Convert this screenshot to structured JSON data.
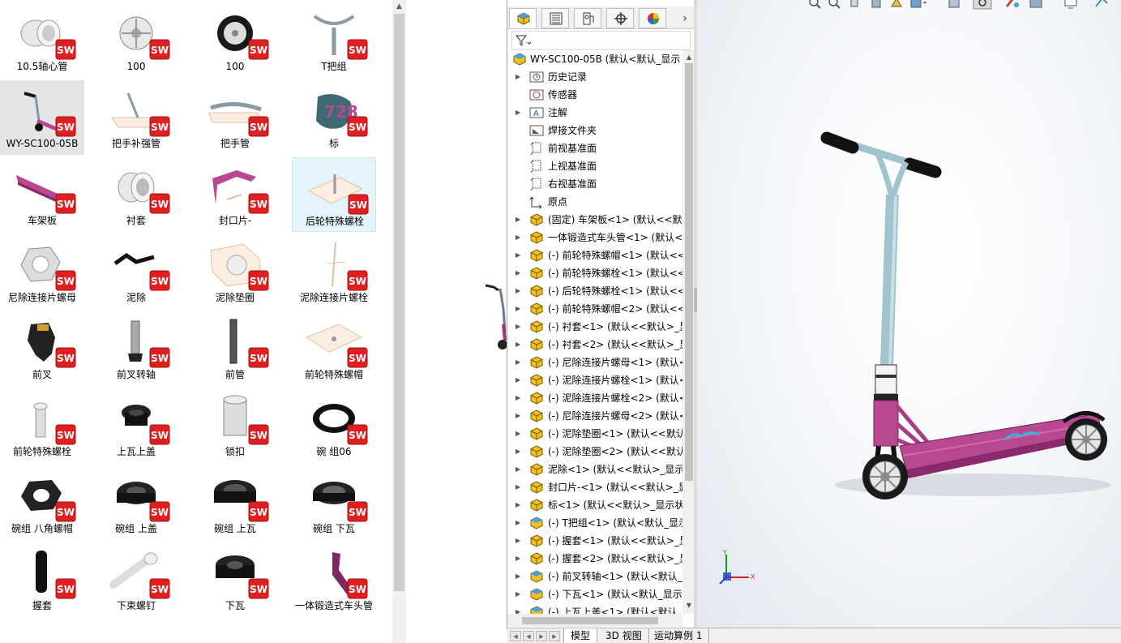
{
  "explorer": {
    "tiles": [
      {
        "label": "10.5轴心管",
        "icon": "tube-part-icon"
      },
      {
        "label": "100",
        "icon": "wheel-rim-icon"
      },
      {
        "label": "100",
        "icon": "wheel-icon"
      },
      {
        "label": "T把组",
        "icon": "t-bar-icon"
      },
      {
        "label": "WY-SC100-05B",
        "icon": "scooter-assembly-icon",
        "selected": true
      },
      {
        "label": "把手补强管",
        "icon": "handlebar-brace-icon"
      },
      {
        "label": "把手管",
        "icon": "handlebar-tube-icon"
      },
      {
        "label": "标",
        "icon": "logo-decal-icon"
      },
      {
        "label": "车架板",
        "icon": "deck-plate-icon"
      },
      {
        "label": "衬套",
        "icon": "bushing-icon"
      },
      {
        "label": "封口片-",
        "icon": "end-cap-icon"
      },
      {
        "label": "后轮特殊螺栓",
        "icon": "rear-axle-bolt-icon",
        "hover": true
      },
      {
        "label": "尼除连接片螺母",
        "icon": "lock-nut-icon"
      },
      {
        "label": "泥除",
        "icon": "fender-icon"
      },
      {
        "label": "泥除垫圈",
        "icon": "fender-washer-icon"
      },
      {
        "label": "泥除连接片螺栓",
        "icon": "fender-bolt-icon"
      },
      {
        "label": "前叉",
        "icon": "fork-icon"
      },
      {
        "label": "前叉转轴",
        "icon": "fork-shaft-icon"
      },
      {
        "label": "前管",
        "icon": "front-tube-icon"
      },
      {
        "label": "前轮特殊螺帽",
        "icon": "front-axle-nut-icon"
      },
      {
        "label": "前轮特殊螺栓",
        "icon": "front-axle-bolt-icon"
      },
      {
        "label": "上瓦上盖",
        "icon": "upper-cup-cover-icon"
      },
      {
        "label": "锁扣",
        "icon": "clamp-icon"
      },
      {
        "label": "碗 组06",
        "icon": "bearing-ring-icon"
      },
      {
        "label": "碗组  八角螺帽",
        "icon": "octagon-nut-icon"
      },
      {
        "label": "碗组  上盖",
        "icon": "headset-cover-icon"
      },
      {
        "label": "碗组  上瓦",
        "icon": "headset-upper-cup-icon"
      },
      {
        "label": "碗组 下瓦",
        "icon": "headset-lower-cup-icon"
      },
      {
        "label": "握套",
        "icon": "grip-icon"
      },
      {
        "label": "下束螺钉",
        "icon": "clamp-screw-icon"
      },
      {
        "label": "下瓦",
        "icon": "lower-cup-icon"
      },
      {
        "label": "一体锻造式车头管",
        "icon": "forged-head-tube-icon"
      }
    ],
    "badge_label": "SW"
  },
  "feature_manager": {
    "tabs": [
      "feature-manager-tab",
      "property-manager-tab",
      "configuration-manager-tab",
      "dimxpert-tab",
      "display-manager-tab"
    ],
    "tree": [
      {
        "text": "WY-SC100-05B  (默认<默认_显示",
        "icon": "assembly-icon",
        "level": 0,
        "expander": "none"
      },
      {
        "text": "历史记录",
        "icon": "history-icon",
        "level": 1,
        "expander": "right"
      },
      {
        "text": "传感器",
        "icon": "sensor-icon",
        "level": 1,
        "expander": "none"
      },
      {
        "text": "注解",
        "icon": "annotation-icon",
        "level": 1,
        "expander": "right"
      },
      {
        "text": "焊接文件夹",
        "icon": "weld-folder-icon",
        "level": 1,
        "expander": "none"
      },
      {
        "text": "前视基准面",
        "icon": "plane-icon",
        "level": 1,
        "expander": "none"
      },
      {
        "text": "上视基准面",
        "icon": "plane-icon",
        "level": 1,
        "expander": "none"
      },
      {
        "text": "右视基准面",
        "icon": "plane-icon",
        "level": 1,
        "expander": "none"
      },
      {
        "text": "原点",
        "icon": "origin-icon",
        "level": 1,
        "expander": "none"
      },
      {
        "text": "(固定) 车架板<1> (默认<<默认",
        "icon": "part-icon",
        "level": 1,
        "expander": "right"
      },
      {
        "text": "一体锻造式车头管<1> (默认<",
        "icon": "part-icon",
        "level": 1,
        "expander": "right"
      },
      {
        "text": "(-) 前轮特殊螺帽<1> (默认<<",
        "icon": "part-icon",
        "level": 1,
        "expander": "right"
      },
      {
        "text": "(-) 前轮特殊螺栓<1> (默认<<",
        "icon": "part-icon",
        "level": 1,
        "expander": "right"
      },
      {
        "text": "(-) 后轮特殊螺栓<1> (默认<<",
        "icon": "part-icon",
        "level": 1,
        "expander": "right"
      },
      {
        "text": "(-) 前轮特殊螺帽<2> (默认<<",
        "icon": "part-icon",
        "level": 1,
        "expander": "right"
      },
      {
        "text": "(-) 衬套<1> (默认<<默认>_显",
        "icon": "part-icon",
        "level": 1,
        "expander": "right"
      },
      {
        "text": "(-) 衬套<2> (默认<<默认>_显",
        "icon": "part-icon",
        "level": 1,
        "expander": "right"
      },
      {
        "text": "(-) 尼除连接片螺母<1> (默认<",
        "icon": "part-icon",
        "level": 1,
        "expander": "right"
      },
      {
        "text": "(-) 泥除连接片螺栓<1> (默认<",
        "icon": "part-icon",
        "level": 1,
        "expander": "right"
      },
      {
        "text": "(-) 泥除连接片螺栓<2> (默认<",
        "icon": "part-icon",
        "level": 1,
        "expander": "right"
      },
      {
        "text": "(-) 尼除连接片螺母<2> (默认<",
        "icon": "part-icon",
        "level": 1,
        "expander": "right"
      },
      {
        "text": "(-) 泥除垫圈<1> (默认<<默认",
        "icon": "part-icon",
        "level": 1,
        "expander": "right"
      },
      {
        "text": "(-) 泥除垫圈<2> (默认<<默认",
        "icon": "part-icon",
        "level": 1,
        "expander": "right"
      },
      {
        "text": "泥除<1> (默认<<默认>_显示",
        "icon": "part-icon",
        "level": 1,
        "expander": "right"
      },
      {
        "text": "封口片-<1> (默认<<默认>_显",
        "icon": "part-icon",
        "level": 1,
        "expander": "right"
      },
      {
        "text": "标<1> (默认<<默认>_显示状",
        "icon": "part-icon",
        "level": 1,
        "expander": "right"
      },
      {
        "text": "(-) T把组<1> (默认<默认_显示",
        "icon": "subassembly-icon",
        "level": 1,
        "expander": "right"
      },
      {
        "text": "(-) 握套<1> (默认<<默认>_显",
        "icon": "part-icon",
        "level": 1,
        "expander": "right"
      },
      {
        "text": "(-) 握套<2> (默认<<默认>_显",
        "icon": "part-icon",
        "level": 1,
        "expander": "right"
      },
      {
        "text": "(-) 前叉转轴<1> (默认<默认_显",
        "icon": "subassembly-icon",
        "level": 1,
        "expander": "right"
      },
      {
        "text": "(-) 下瓦<1> (默认<默认_显示",
        "icon": "subassembly-icon",
        "level": 1,
        "expander": "right"
      },
      {
        "text": "(-) 上瓦上盖<1> (默认<默认_",
        "icon": "subassembly-icon",
        "level": 1,
        "expander": "right"
      }
    ]
  },
  "bottom_tabs": [
    "模型",
    "3D 视图",
    "运动算例 1"
  ],
  "colors": {
    "deck": "#b8488f",
    "bar": "#9fc4cc",
    "sw_red": "#e02020",
    "part_yellow": "#f0c020",
    "selection_bg": "#e5e5e5",
    "hover_bg": "#e5f3fb"
  }
}
